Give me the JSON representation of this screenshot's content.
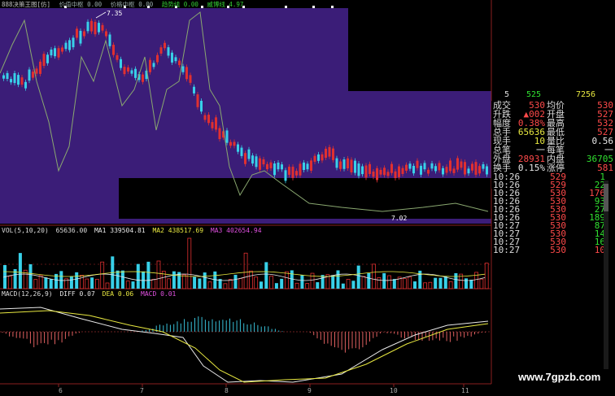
{
  "title_bar": {
    "name": "888决策王图[仿]",
    "items": [
      "价值中枢 0.00",
      "价格中枢 0.00",
      "趋势线 0.00",
      "威博线 4.97"
    ]
  },
  "price_high_label": "7.35",
  "price_low_label": "7.02",
  "quote_header": {
    "left": "5",
    "buy_price": "525",
    "buy_vol": "7256"
  },
  "quote": {
    "rows": [
      {
        "k1": "成交",
        "v1": "530",
        "c1": "#ff4a4a",
        "k2": "均价",
        "v2": "530",
        "c2": "#ff4a4a"
      },
      {
        "k1": "升跌",
        "v1": "▲002",
        "c1": "#ff4a4a",
        "k2": "开盘",
        "v2": "527",
        "c2": "#ff4a4a"
      },
      {
        "k1": "幅度",
        "v1": "0.38%",
        "c1": "#ff4a4a",
        "k2": "最高",
        "v2": "532",
        "c2": "#ff4a4a"
      },
      {
        "k1": "总手",
        "v1": "65636",
        "c1": "#e8e840",
        "k2": "最低",
        "v2": "527",
        "c2": "#ff4a4a"
      },
      {
        "k1": "现手",
        "v1": "10",
        "c1": "#e8e840",
        "k2": "量比",
        "v2": "0.56",
        "c2": "#e8e8e8"
      },
      {
        "k1": "总笔",
        "v1": "一",
        "c1": "#e8e8e8",
        "k2": "每笔",
        "v2": "一",
        "c2": "#e8e8e8"
      },
      {
        "k1": "外盘",
        "v1": "28931",
        "c1": "#ff4a4a",
        "k2": "内盘",
        "v2": "36705",
        "c2": "#30e030"
      },
      {
        "k1": "换手",
        "v1": "0.15%",
        "c1": "#e8e8e8",
        "k2": "涨停",
        "v2": "581",
        "c2": "#ff4a4a"
      }
    ]
  },
  "ticks": [
    {
      "time": "10:26",
      "price": "529",
      "vol": "1",
      "vc": "#30e030"
    },
    {
      "time": "10:26",
      "price": "529",
      "vol": "22",
      "vc": "#30e030"
    },
    {
      "time": "10:26",
      "price": "530",
      "vol": "176",
      "vc": "#ff4a4a"
    },
    {
      "time": "10:26",
      "price": "530",
      "vol": "93",
      "vc": "#30e030"
    },
    {
      "time": "10:26",
      "price": "530",
      "vol": "27",
      "vc": "#30e030"
    },
    {
      "time": "10:26",
      "price": "530",
      "vol": "189",
      "vc": "#30e030"
    },
    {
      "time": "10:27",
      "price": "530",
      "vol": "87",
      "vc": "#30e030"
    },
    {
      "time": "10:27",
      "price": "530",
      "vol": "14",
      "vc": "#30e030"
    },
    {
      "time": "10:27",
      "price": "530",
      "vol": "16",
      "vc": "#30e030"
    },
    {
      "time": "10:27",
      "price": "530",
      "vol": "10",
      "vc": "#ff4a4a"
    }
  ],
  "vol_label": {
    "name": "VOL(5,10,20)",
    "value": "65636.00",
    "ma1": "MA1 339504.81",
    "ma2": "MA2 438517.69",
    "ma3": "MA3 402654.94"
  },
  "macd_label": {
    "name": "MACD(12,26,9)",
    "diff": "DIFF 0.07",
    "dea": "DEA 0.06",
    "macd": "MACD 0.01"
  },
  "x_labels": [
    "6",
    "7",
    "8",
    "9",
    "10",
    "11"
  ],
  "watermark": "www.7gpzb.com",
  "colors": {
    "chart_bg": "#3b1d78",
    "up": "#e03030",
    "down": "#38d0e8",
    "line": "#8aa870",
    "grid": "#8a2020"
  }
}
